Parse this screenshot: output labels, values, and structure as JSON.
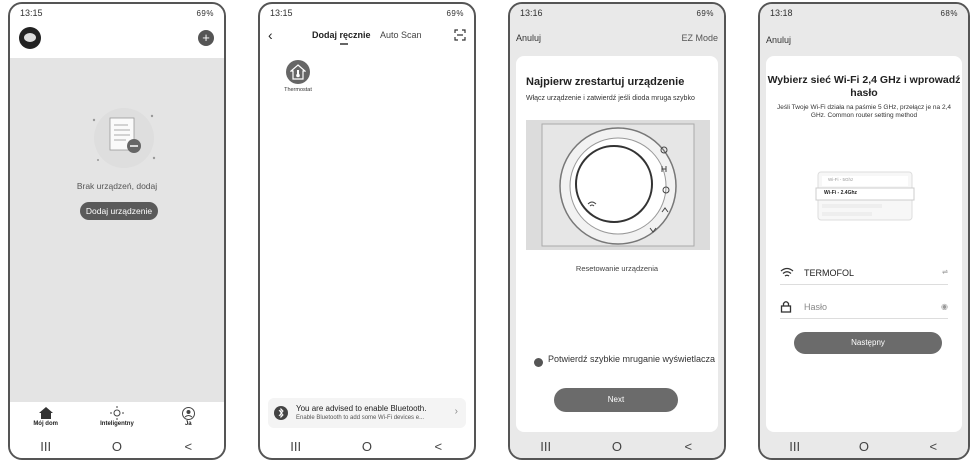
{
  "phone1": {
    "status_time": "13:15",
    "status_battery": "69%",
    "empty_text": "Brak urządzeń, dodaj",
    "add_button": "Dodaj urządzenie",
    "tabs": [
      {
        "label": "Mój dom",
        "icon": "home-icon"
      },
      {
        "label": "Inteligentny",
        "icon": "sun-icon"
      },
      {
        "label": "Ja",
        "icon": "user-icon"
      }
    ]
  },
  "phone2": {
    "status_time": "13:15",
    "status_battery": "69%",
    "tab_manual": "Dodaj ręcznie",
    "tab_auto": "Auto Scan",
    "device_label": "Thermostat",
    "bt_title": "You are advised to enable Bluetooth.",
    "bt_subtitle": "Enable Bluetooth to add some Wi-Fi devices e..."
  },
  "phone3": {
    "status_time": "13:16",
    "status_battery": "69%",
    "cancel": "Anuluj",
    "mode": "EZ Mode",
    "title": "Najpierw zrestartuj urządzenie",
    "description": "Włącz urządzenie i zatwierdź jeśli dioda mruga szybko",
    "reset_link": "Resetowanie urządzenia",
    "confirm_text": "Potwierdź szybkie mruganie wyświetlacza",
    "next_button": "Next"
  },
  "phone4": {
    "status_time": "13:18",
    "status_battery": "68%",
    "cancel": "Anuluj",
    "title": "Wybierz sieć Wi-Fi 2,4 GHz i wprowadź hasło",
    "description": "Jeśli Twoje Wi-Fi działa na paśmie 5 GHz, przełącz je na 2,4 GHz. Common router setting method",
    "illus_row1": "Wi-Fi - 5Ghz",
    "illus_row2": "Wi-Fi - 2.4Ghz",
    "ssid": "TERMOFOL",
    "password_placeholder": "Hasło",
    "next_button": "Następny"
  },
  "nav": {
    "recent": "III",
    "home": "O",
    "back": "<"
  }
}
